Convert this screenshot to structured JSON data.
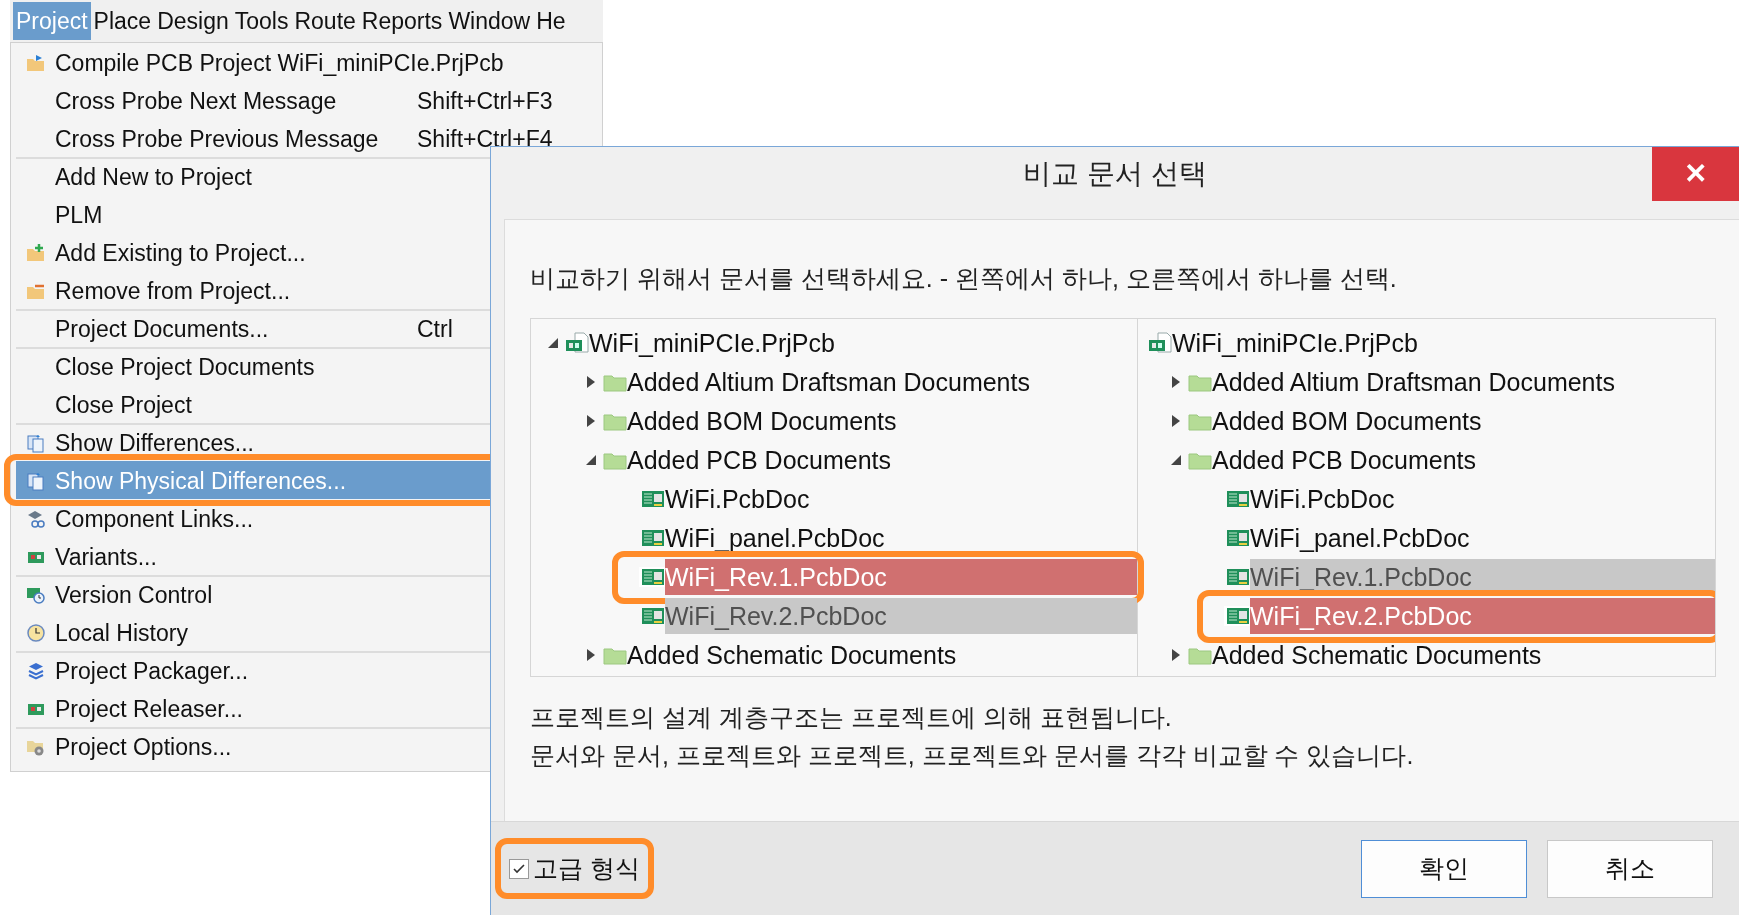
{
  "menu_bar": [
    {
      "label": "Project",
      "selected": true
    },
    {
      "label": "Place",
      "selected": false
    },
    {
      "label": "Design",
      "selected": false
    },
    {
      "label": "Tools",
      "selected": false
    },
    {
      "label": "Route",
      "selected": false
    },
    {
      "label": "Reports",
      "selected": false
    },
    {
      "label": "Window",
      "selected": false
    },
    {
      "label": "He",
      "selected": false
    }
  ],
  "menu": [
    {
      "label": "Compile PCB Project WiFi_miniPCIe.PrjPcb",
      "kind": "compile",
      "separator_before": false,
      "selected": false,
      "annotated": false
    },
    {
      "label": "Cross Probe Next Message",
      "kind": "plain",
      "shortcut": "Shift+Ctrl+F3",
      "separator_before": false,
      "selected": false,
      "annotated": false
    },
    {
      "label": "Cross Probe Previous Message",
      "kind": "plain",
      "shortcut": "Shift+Ctrl+F4",
      "separator_before": false,
      "selected": false,
      "annotated": false
    },
    {
      "label": "Add New to Project",
      "kind": "plain",
      "separator_before": true,
      "selected": false,
      "annotated": false
    },
    {
      "label": "PLM",
      "kind": "plain",
      "separator_before": false,
      "selected": false,
      "annotated": false
    },
    {
      "label": "Add Existing to Project...",
      "kind": "add",
      "separator_before": false,
      "selected": false,
      "annotated": false
    },
    {
      "label": "Remove from Project...",
      "kind": "remove",
      "separator_before": false,
      "selected": false,
      "annotated": false
    },
    {
      "label": "Project Documents...",
      "kind": "plain",
      "shortcut": "Ctrl",
      "separator_before": true,
      "selected": false,
      "annotated": false
    },
    {
      "label": "Close Project Documents",
      "kind": "plain",
      "separator_before": true,
      "selected": false,
      "annotated": false
    },
    {
      "label": "Close Project",
      "kind": "plain",
      "separator_before": false,
      "selected": false,
      "annotated": false
    },
    {
      "label": "Show Differences...",
      "kind": "diff",
      "separator_before": true,
      "selected": false,
      "annotated": false
    },
    {
      "label": "Show Physical Differences...",
      "kind": "diff",
      "separator_before": false,
      "selected": true,
      "annotated": true
    },
    {
      "label": "Component Links...",
      "kind": "links",
      "separator_before": false,
      "selected": false,
      "annotated": false
    },
    {
      "label": "Variants...",
      "kind": "board",
      "separator_before": false,
      "selected": false,
      "annotated": false
    },
    {
      "label": "Version Control",
      "kind": "version",
      "separator_before": true,
      "selected": false,
      "annotated": false
    },
    {
      "label": "Local History",
      "kind": "clock",
      "separator_before": false,
      "selected": false,
      "annotated": false
    },
    {
      "label": "Project Packager...",
      "kind": "packager",
      "separator_before": true,
      "selected": false,
      "annotated": false
    },
    {
      "label": "Project Releaser...",
      "kind": "board",
      "separator_before": false,
      "selected": false,
      "annotated": false
    },
    {
      "label": "Project Options...",
      "kind": "options",
      "separator_before": true,
      "selected": false,
      "annotated": false
    }
  ],
  "dialog": {
    "title": "비교 문서 선택",
    "close": "✕",
    "instruction": "비교하기 위해서 문서를 선택하세요. - 왼쪽에서 하나, 오른쪽에서 하나를 선택.",
    "trees": [
      {
        "label": "WiFi_miniPCIe.PrjPcb",
        "kind": "project",
        "expanded": true,
        "children": [
          {
            "label": "Added Altium Draftsman Documents",
            "kind": "folder",
            "expanded": false
          },
          {
            "label": "Added BOM Documents",
            "kind": "folder",
            "expanded": false
          },
          {
            "label": "Added PCB Documents",
            "kind": "folder",
            "expanded": true,
            "children": [
              {
                "label": "WiFi.PcbDoc",
                "kind": "pcb",
                "selected": false,
                "dimmed": false,
                "annotated": false
              },
              {
                "label": "WiFi_panel.PcbDoc",
                "kind": "pcb",
                "selected": false,
                "dimmed": false,
                "annotated": false
              },
              {
                "label": "WiFi_Rev.1.PcbDoc",
                "kind": "pcb",
                "selected": true,
                "dimmed": false,
                "annotated": true
              },
              {
                "label": "WiFi_Rev.2.PcbDoc",
                "kind": "pcb",
                "selected": false,
                "dimmed": true,
                "annotated": false
              }
            ]
          },
          {
            "label": "Added Schematic Documents",
            "kind": "folder",
            "expanded": false
          }
        ]
      },
      {
        "label": "WiFi_miniPCIe.PrjPcb",
        "kind": "project",
        "children": [
          {
            "label": "Added Altium Draftsman Documents",
            "kind": "folder",
            "expanded": false
          },
          {
            "label": "Added BOM Documents",
            "kind": "folder",
            "expanded": false
          },
          {
            "label": "Added PCB Documents",
            "kind": "folder",
            "expanded": true,
            "children": [
              {
                "label": "WiFi.PcbDoc",
                "kind": "pcb",
                "selected": false,
                "dimmed": false,
                "annotated": false
              },
              {
                "label": "WiFi_panel.PcbDoc",
                "kind": "pcb",
                "selected": false,
                "dimmed": false,
                "annotated": false
              },
              {
                "label": "WiFi_Rev.1.PcbDoc",
                "kind": "pcb",
                "selected": false,
                "dimmed": true,
                "annotated": false
              },
              {
                "label": "WiFi_Rev.2.PcbDoc",
                "kind": "pcb",
                "selected": true,
                "dimmed": false,
                "annotated": true
              }
            ]
          },
          {
            "label": "Added Schematic Documents",
            "kind": "folder",
            "expanded": false
          }
        ]
      }
    ],
    "notes": [
      "프로젝트의 설계 계층구조는 프로젝트에 의해 표현됩니다.",
      "문서와 문서, 프로젝트와 프로젝트, 프로젝트와 문서를 각각 비교할 수 있습니다."
    ],
    "checkbox": {
      "label": "고급 형식",
      "checked": true,
      "annotated": true
    },
    "buttons": [
      {
        "label": "확인",
        "kind": "default"
      },
      {
        "label": "취소",
        "kind": "normal"
      }
    ]
  }
}
